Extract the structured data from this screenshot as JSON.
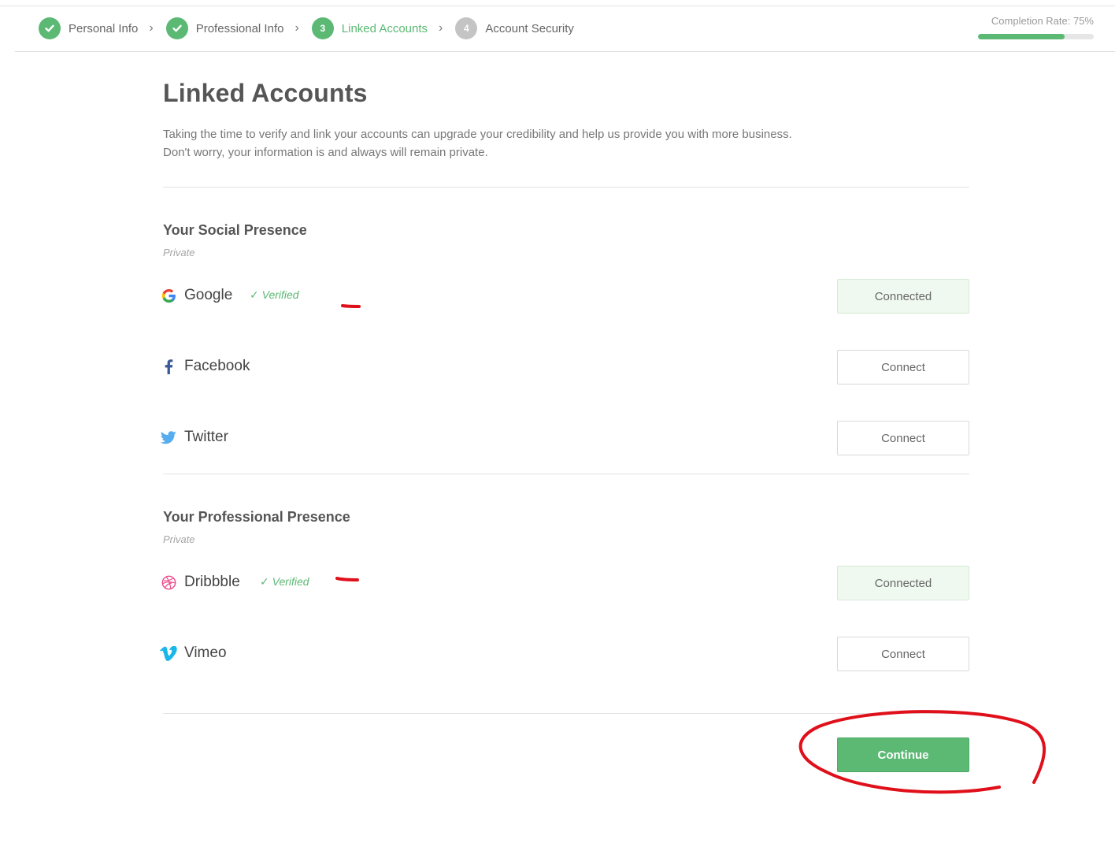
{
  "steps": [
    {
      "number": "1",
      "label": "Personal Info",
      "state": "done"
    },
    {
      "number": "2",
      "label": "Professional Info",
      "state": "done"
    },
    {
      "number": "3",
      "label": "Linked Accounts",
      "state": "active"
    },
    {
      "number": "4",
      "label": "Account Security",
      "state": "todo"
    }
  ],
  "completion": {
    "label": "Completion Rate: 75%",
    "value": 0.75
  },
  "page": {
    "title": "Linked Accounts",
    "intro": "Taking the time to verify and link your accounts can upgrade your credibility and help us provide you with more business. Don't worry, your information is and always will remain private."
  },
  "social": {
    "title": "Your Social Presence",
    "subtitle": "Private",
    "accounts": [
      {
        "name": "Google",
        "verified": "✓ Verified",
        "button": "Connected",
        "icon": "google-icon"
      },
      {
        "name": "Facebook",
        "button": "Connect",
        "icon": "facebook-icon"
      },
      {
        "name": "Twitter",
        "button": "Connect",
        "icon": "twitter-icon"
      }
    ]
  },
  "professional": {
    "title": "Your Professional Presence",
    "subtitle": "Private",
    "accounts": [
      {
        "name": "Dribbble",
        "verified": "✓ Verified",
        "button": "Connected",
        "icon": "dribbble-icon"
      },
      {
        "name": "Vimeo",
        "button": "Connect",
        "icon": "vimeo-icon"
      }
    ]
  },
  "actions": {
    "continue_label": "Continue"
  },
  "colors": {
    "accent": "#5bb974",
    "annotation": "#e0101a"
  }
}
